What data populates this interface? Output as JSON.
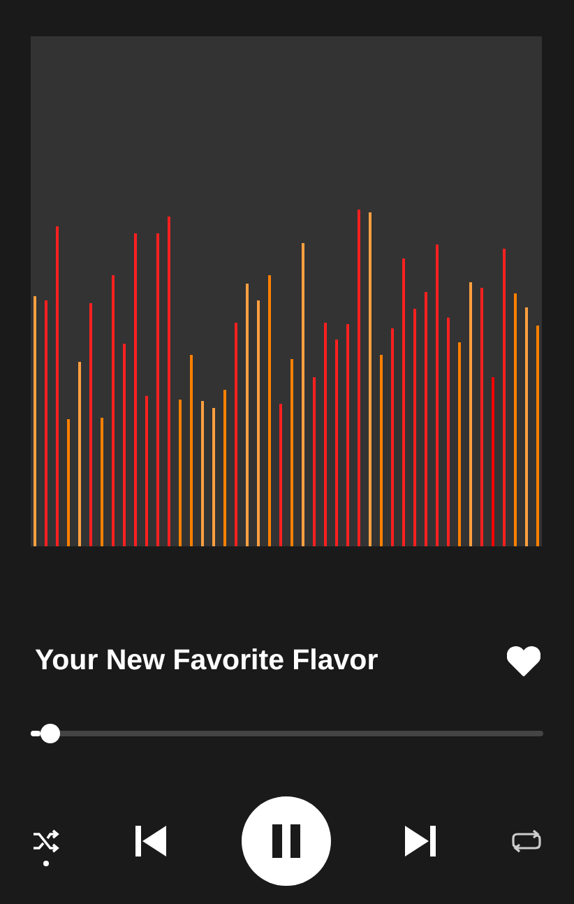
{
  "track": {
    "title": "Your New Favorite Flavor",
    "liked": true
  },
  "progress": {
    "level": 0.02
  },
  "controls": {
    "shuffle": true,
    "repeat": false,
    "playing": true
  }
}
